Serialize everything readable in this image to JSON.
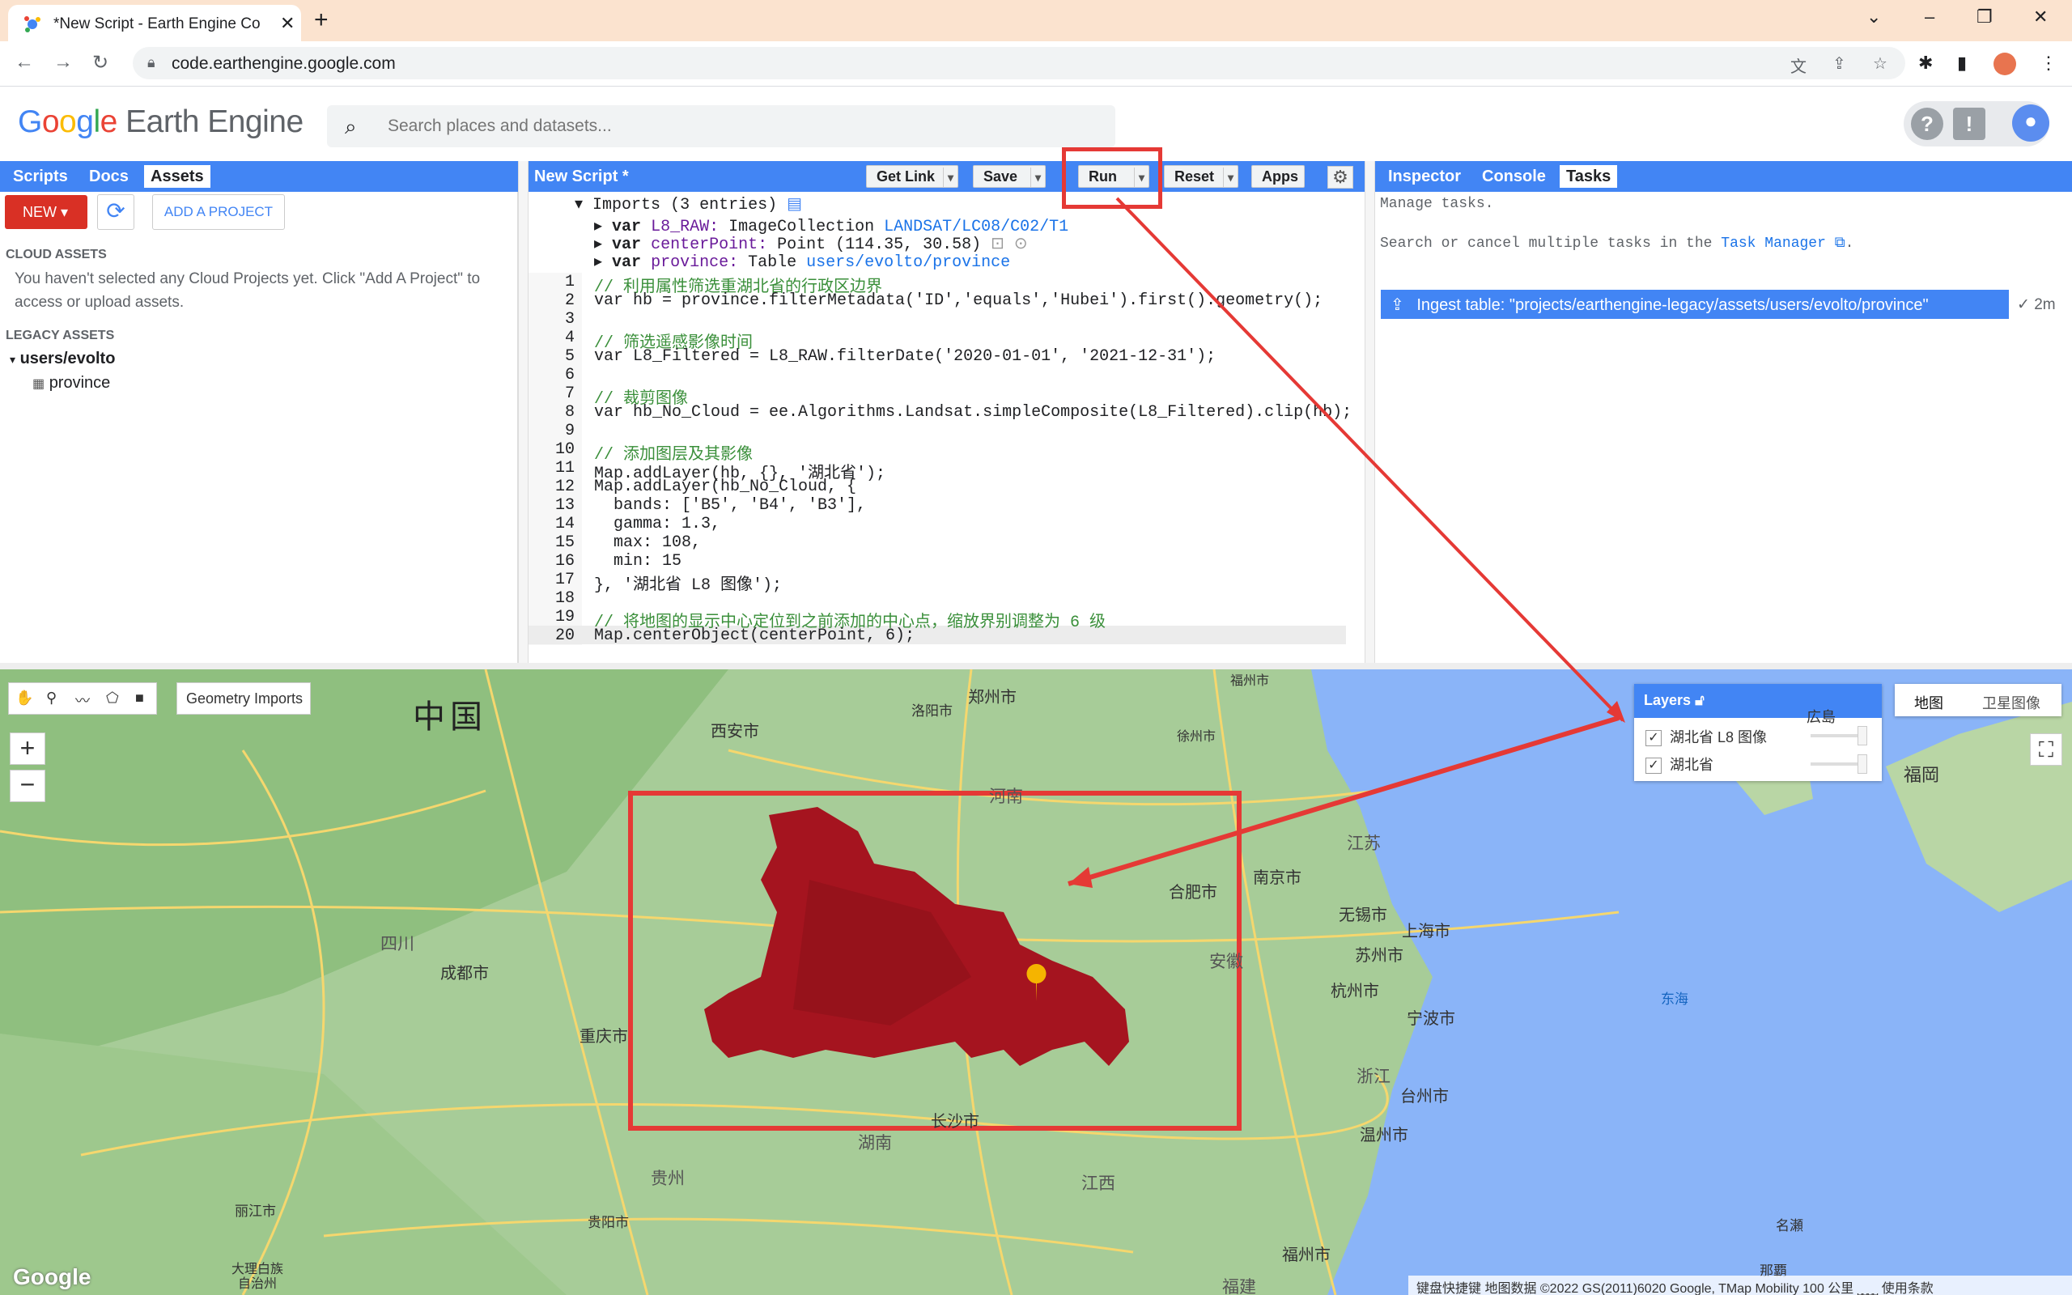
{
  "browser": {
    "tab_title": "*New Script - Earth Engine Co",
    "url": "code.earthengine.google.com"
  },
  "header": {
    "logo_google": "Google",
    "logo_product": "Earth Engine",
    "search_placeholder": "Search places and datasets..."
  },
  "left_panel": {
    "tabs": [
      "Scripts",
      "Docs",
      "Assets"
    ],
    "active_tab": "Assets",
    "new_label": "NEW",
    "add_project_label": "ADD A PROJECT",
    "cloud_assets_heading": "CLOUD ASSETS",
    "cloud_assets_msg": "You haven't selected any Cloud Projects yet. Click \"Add A Project\" to access or upload assets.",
    "legacy_assets_heading": "LEGACY ASSETS",
    "user_folder": "users/evolto",
    "asset_item": "province"
  },
  "editor": {
    "title": "New Script *",
    "buttons": {
      "get_link": "Get Link",
      "save": "Save",
      "run": "Run",
      "reset": "Reset",
      "apps": "Apps"
    },
    "imports_header": "Imports (3 entries)",
    "imports": [
      {
        "kw": "var",
        "name": "L8_RAW",
        "type": "ImageCollection",
        "value": "LANDSAT/LC08/C02/T1"
      },
      {
        "kw": "var",
        "name": "centerPoint",
        "type": "Point",
        "value": "(114.35, 30.58)"
      },
      {
        "kw": "var",
        "name": "province",
        "type": "Table",
        "value": "users/evolto/province"
      }
    ],
    "lines": [
      "// 利用属性筛选重湖北省的行政区边界",
      "var hb = province.filterMetadata('ID','equals','Hubei').first().geometry();",
      "",
      "// 筛选遥感影像时间",
      "var L8_Filtered = L8_RAW.filterDate('2020-01-01', '2021-12-31');",
      "",
      "// 裁剪图像",
      "var hb_No_Cloud = ee.Algorithms.Landsat.simpleComposite(L8_Filtered).clip(hb);",
      "",
      "// 添加图层及其影像",
      "Map.addLayer(hb, {}, '湖北省');",
      "Map.addLayer(hb_No_Cloud, {",
      "  bands: ['B5', 'B4', 'B3'],",
      "  gamma: 1.3,",
      "  max: 108,",
      "  min: 15",
      "}, '湖北省 L8 图像');",
      "",
      "// 将地图的显示中心定位到之前添加的中心点，缩放界别调整为 6 级",
      "Map.centerObject(centerPoint, 6);"
    ]
  },
  "right_panel": {
    "tabs": [
      "Inspector",
      "Console",
      "Tasks"
    ],
    "active_tab": "Tasks",
    "manage_text": "Manage tasks.",
    "search_text_pre": "Search or cancel multiple tasks in the ",
    "task_manager_link": "Task Manager",
    "search_text_post": ".",
    "task_label": "Ingest table: \"projects/earthengine-legacy/assets/users/evolto/province\"",
    "task_time": "2m"
  },
  "map": {
    "geometry_imports": "Geometry Imports",
    "layers_title": "Layers",
    "layers": [
      "湖北省 L8 图像",
      "湖北省"
    ],
    "map_types": [
      "地图",
      "卫星图像"
    ],
    "attribution": "键盘快捷键  地图数据 ©2022 GS(2011)6020 Google, TMap Mobility   100 公里 ⎵⎵⎵⎵    使用条款",
    "google_logo": "Google",
    "labels": {
      "china": "中国",
      "zhengzhou": "郑州市",
      "xian": "西安市",
      "luoyang": "洛阳市",
      "henan": "河南",
      "xuzhou": "徐州市",
      "fuzhou_n": "福州市",
      "fukuoka": "福岡",
      "sichuan": "四川",
      "chengdu": "成都市",
      "chongqing": "重庆市",
      "hefei": "合肥市",
      "nanjing": "南京市",
      "jiangsu": "江苏",
      "wuxi": "无锡市",
      "suzhou": "苏州市",
      "shanghai": "上海市",
      "anhui": "安徽",
      "hangzhou": "杭州市",
      "ningbo": "宁波市",
      "donghai": "东海",
      "zhejiang": "浙江",
      "taizhou": "台州市",
      "wenzhou": "温州市",
      "changsha": "长沙市",
      "hunan": "湖南",
      "guizhou": "贵州",
      "jiangxi": "江西",
      "guiyang": "贵阳市",
      "lijiang": "丽江市",
      "dali": "大理白族自治州",
      "fuzhou": "福州市",
      "fujian": "福建",
      "naze": "名瀬",
      "naha": "那覇",
      "guangzhou_r": "広島"
    }
  },
  "colors": {
    "accent": "#4285f4",
    "run_highlight": "#e53935",
    "new_button": "#d93025",
    "hubei_fill": "#a5141f"
  }
}
